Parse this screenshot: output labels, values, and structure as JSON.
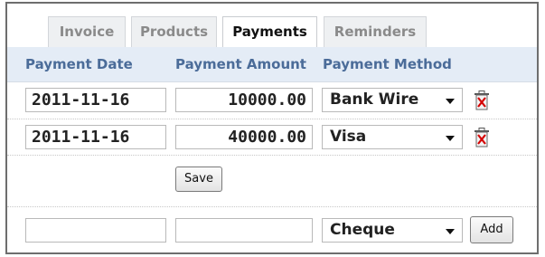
{
  "tabs": [
    {
      "label": "Invoice",
      "active": false
    },
    {
      "label": "Products",
      "active": false
    },
    {
      "label": "Payments",
      "active": true
    },
    {
      "label": "Reminders",
      "active": false
    }
  ],
  "columns": {
    "date": "Payment Date",
    "amount": "Payment Amount",
    "method": "Payment Method"
  },
  "payments": [
    {
      "date": "2011-11-16",
      "amount": "10000.00",
      "method": "Bank Wire"
    },
    {
      "date": "2011-11-16",
      "amount": "40000.00",
      "method": "Visa"
    }
  ],
  "save_label": "Save",
  "new_payment": {
    "date": "",
    "amount": "",
    "method": "Cheque",
    "add_label": "Add"
  },
  "colors": {
    "header_bg": "#e4ecf6",
    "header_text": "#4b6c99",
    "delete_red": "#d40000"
  },
  "icons": {
    "delete": "trash-icon",
    "dropdown": "chevron-down-icon"
  }
}
